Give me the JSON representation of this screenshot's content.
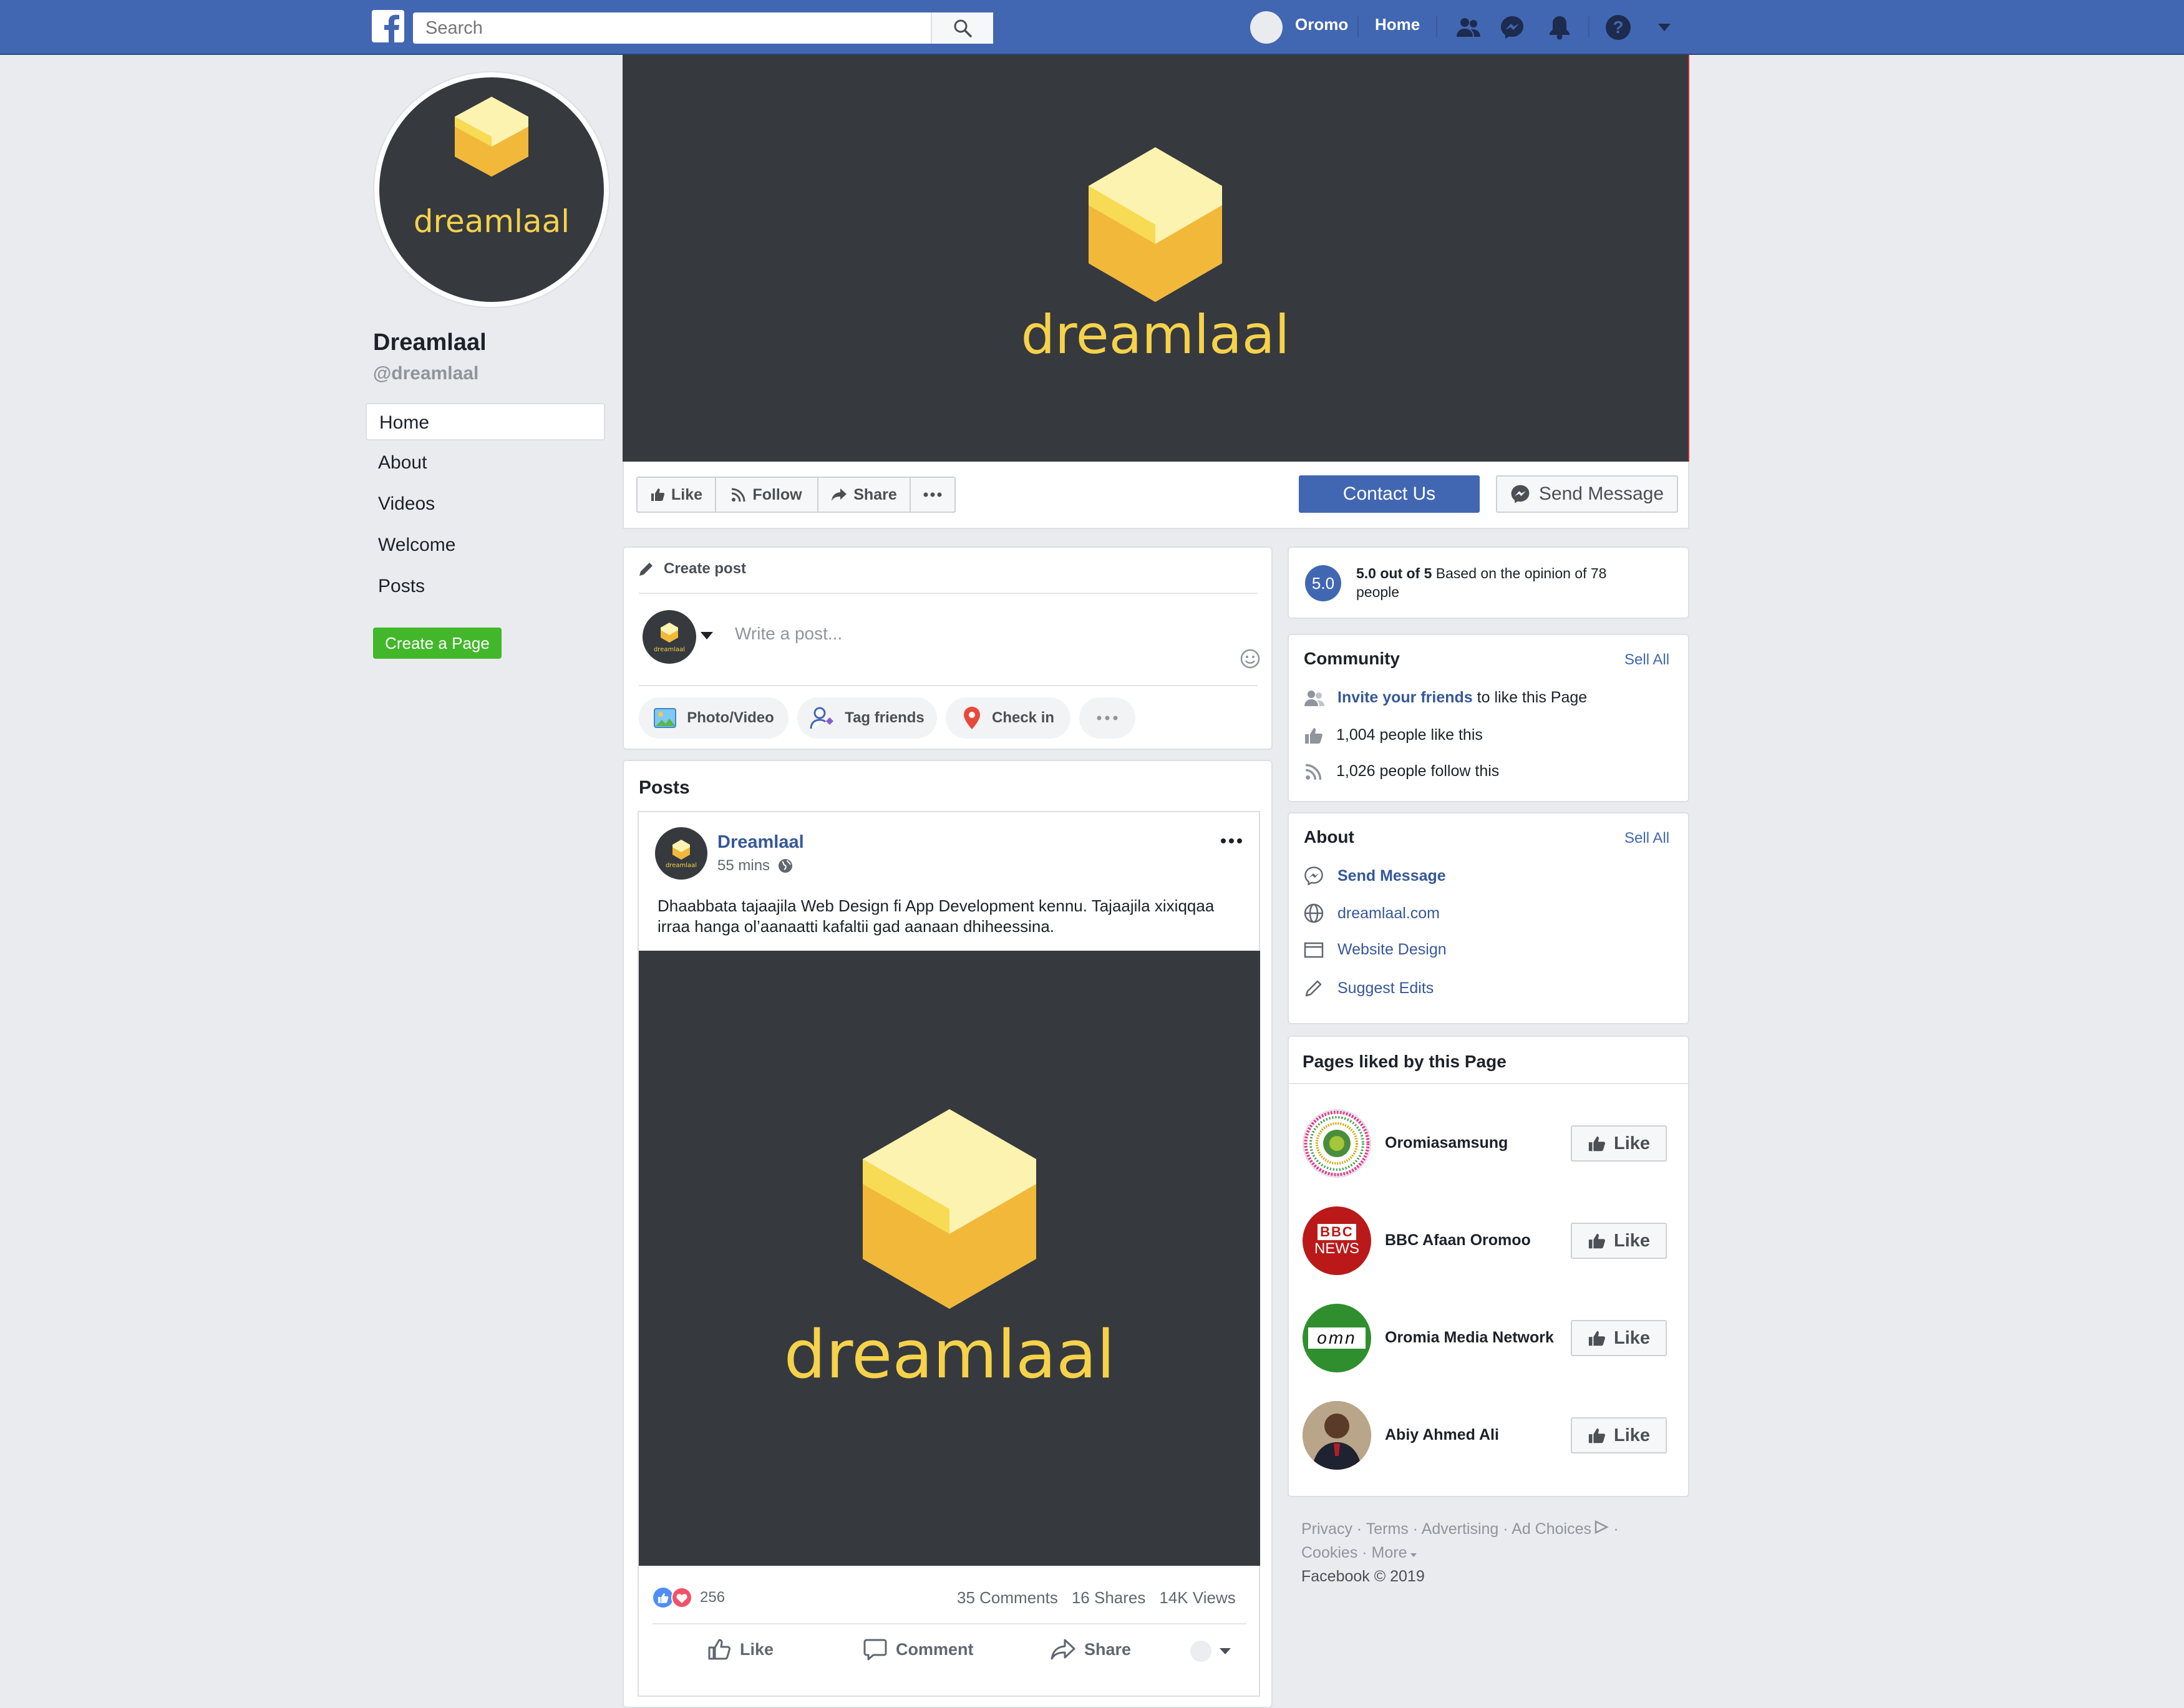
{
  "topbar": {
    "search_placeholder": "Search",
    "user_name": "Oromo",
    "home_label": "Home"
  },
  "page": {
    "name": "Dreamlaal",
    "handle": "@dreamlaal",
    "logo_text": "dreamlaal",
    "logo_small_text": "dreamlaal"
  },
  "left_nav": {
    "items": [
      {
        "label": "Home"
      },
      {
        "label": "About"
      },
      {
        "label": "Videos"
      },
      {
        "label": "Welcome"
      },
      {
        "label": "Posts"
      }
    ],
    "create_page_label": "Create a Page"
  },
  "actions": {
    "like": "Like",
    "follow": "Follow",
    "share": "Share",
    "contact": "Contact Us",
    "send_message": "Send Message"
  },
  "create_post": {
    "title": "Create post",
    "placeholder": "Write a post...",
    "photo_video": "Photo/Video",
    "tag_friends": "Tag friends",
    "check_in": "Check in"
  },
  "posts_section": {
    "title": "Posts",
    "post": {
      "author": "Dreamlaal",
      "time": "55 mins",
      "text_line1": "Dhaabbata tajaajila Web Design fi App Development kennu. Tajaajila xixiqqaa",
      "text_line2": "irraa hanga ol’aanaatti kafaltii gad aanaan dhiheessina.",
      "image_logo_text": "dreamlaal",
      "reactions_count": "256",
      "comments": "35 Comments",
      "shares": "16 Shares",
      "views": "14K Views",
      "like_label": "Like",
      "comment_label": "Comment",
      "share_label": "Share"
    }
  },
  "rating": {
    "score": "5.0",
    "score_text": "5.0 out of 5",
    "based_text": "Based  on the opinion of 78",
    "based_text2": "people"
  },
  "community": {
    "title": "Community",
    "see_all": "Sell All",
    "invite_link": "Invite your friends",
    "invite_rest": " to like this Page",
    "likes": "1,004 people like this",
    "follows": "1,026 people follow this"
  },
  "about": {
    "title": "About",
    "see_all": "Sell All",
    "send_message": "Send Message",
    "website": "dreamlaal.com",
    "category": "Website Design",
    "suggest": "Suggest Edits"
  },
  "pages_liked": {
    "title": "Pages liked by this Page",
    "like_label": "Like",
    "items": [
      {
        "name": "Oromiasamsung"
      },
      {
        "name": "BBC Afaan Oromoo",
        "badge_top": "BBC",
        "badge_bottom": "NEWS"
      },
      {
        "name": "Oromia Media Network",
        "logo_text": "omn"
      },
      {
        "name": "Abiy Ahmed Ali"
      }
    ]
  },
  "footer": {
    "line1": [
      "Privacy",
      "Terms",
      "Advertising",
      "Ad Choices"
    ],
    "line2": [
      "Cookies",
      "More"
    ],
    "copyright": "Facebook © 2019"
  },
  "colors": {
    "brand_blue": "#4267b2",
    "dark_logo_bg": "#36393e",
    "logo_yellow": "#f5d24a",
    "green_button": "#42b72a"
  }
}
